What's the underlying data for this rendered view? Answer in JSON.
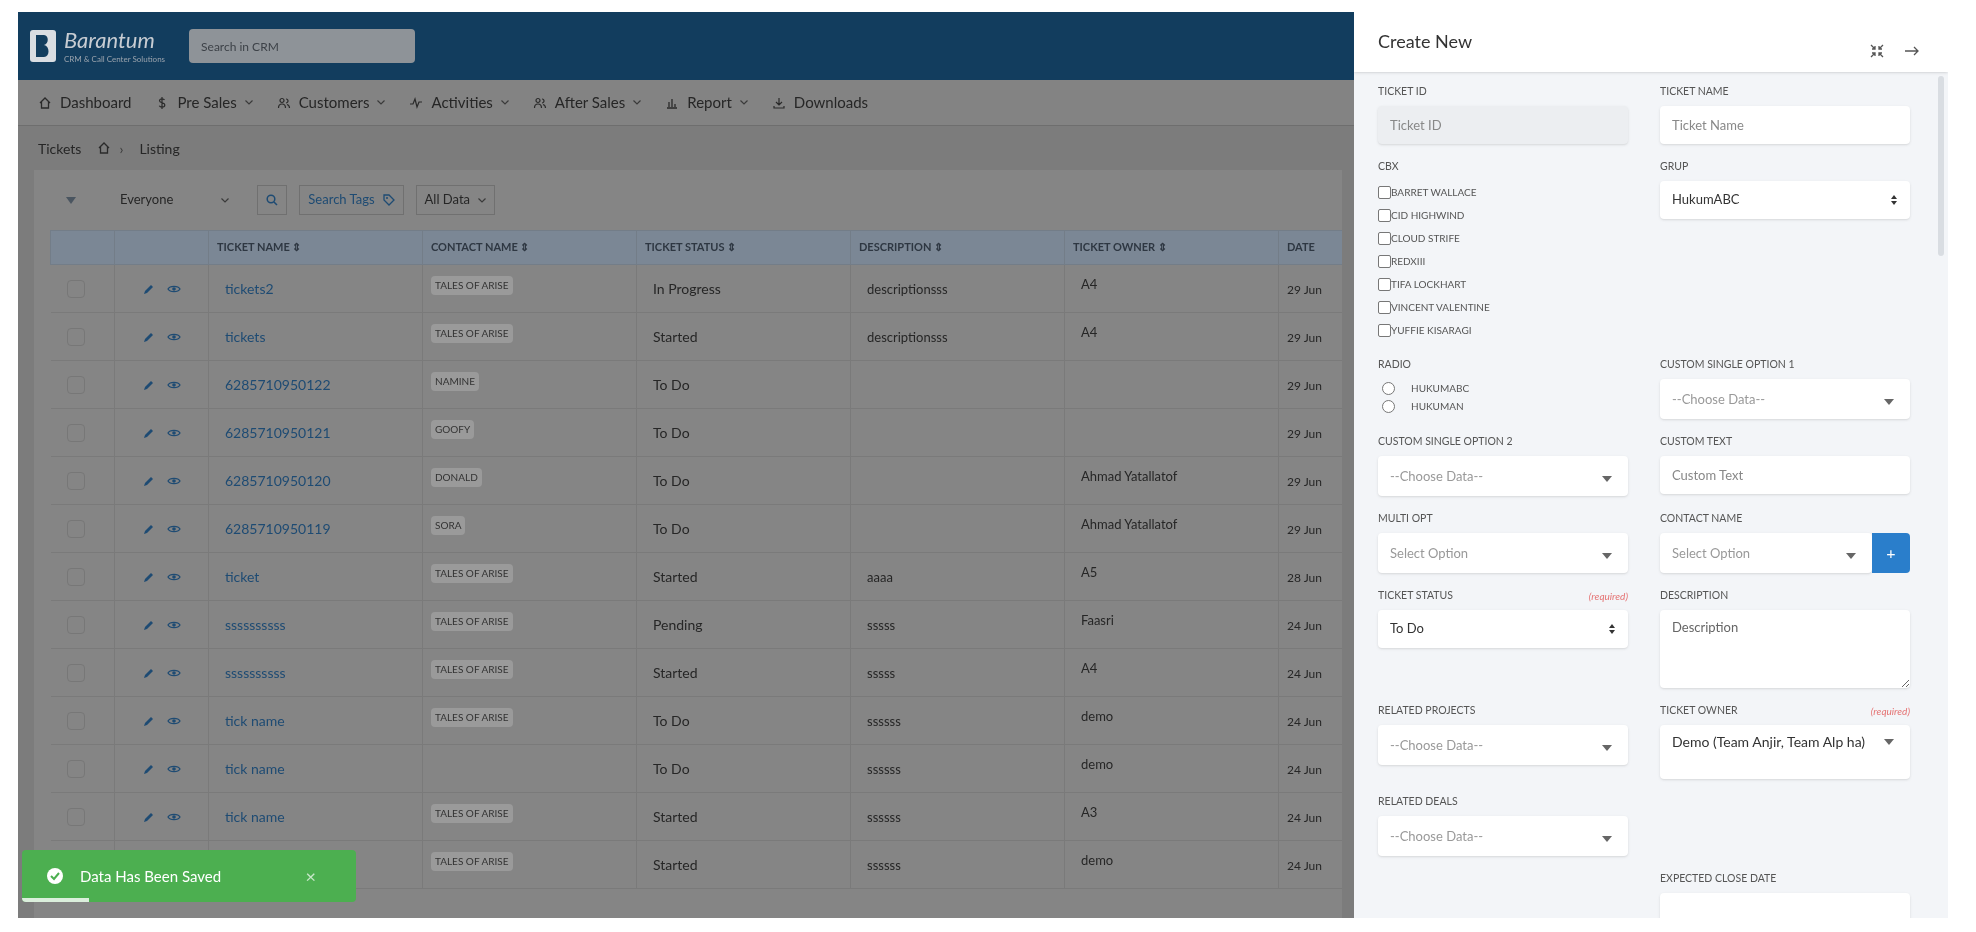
{
  "header": {
    "logo": "Barantum",
    "tagline": "CRM & Call Center Solutions",
    "search": {
      "placeholder": "Search in CRM"
    }
  },
  "nav": [
    {
      "label": "Dashboard",
      "dropdown": false
    },
    {
      "label": "Pre Sales",
      "dropdown": true
    },
    {
      "label": "Customers",
      "dropdown": true
    },
    {
      "label": "Activities",
      "dropdown": true
    },
    {
      "label": "After Sales",
      "dropdown": true
    },
    {
      "label": "Report",
      "dropdown": true
    },
    {
      "label": "Downloads",
      "dropdown": false
    }
  ],
  "breadcrumb": {
    "title": "Tickets",
    "separator": "›",
    "current": "Listing"
  },
  "toolbar": {
    "owner_filter": "Everyone",
    "tags_button": "Search Tags",
    "data_filter": "All Data"
  },
  "table": {
    "columns": [
      "TICKET NAME ⇕",
      "CONTACT NAME ⇕",
      "TICKET STATUS ⇕",
      "DESCRIPTION ⇕",
      "TICKET OWNER ⇕",
      "DATE"
    ],
    "rows": [
      {
        "checked": false,
        "ticket_name": "tickets2",
        "contact": "TALES OF ARISE",
        "status": "In Progress",
        "description": "descriptionsss",
        "owner": "A4",
        "date": "29 Jun"
      },
      {
        "checked": false,
        "ticket_name": "tickets",
        "contact": "TALES OF ARISE",
        "status": "Started",
        "description": "descriptionsss",
        "owner": "A4",
        "date": "29 Jun"
      },
      {
        "checked": false,
        "ticket_name": "6285710950122",
        "contact": "NAMINE",
        "status": "To Do",
        "date": "29 Jun"
      },
      {
        "checked": false,
        "ticket_name": "6285710950121",
        "contact": "GOOFY",
        "status": "To Do",
        "date": "29 Jun"
      },
      {
        "checked": false,
        "ticket_name": "6285710950120",
        "contact": "DONALD",
        "status": "To Do",
        "owner": "Ahmad Yatallatof",
        "date": "29 Jun"
      },
      {
        "checked": false,
        "ticket_name": "6285710950119",
        "contact": "SORA",
        "status": "To Do",
        "owner": "Ahmad Yatallatof",
        "date": "29 Jun"
      },
      {
        "checked": false,
        "ticket_name": "ticket",
        "contact": "TALES OF ARISE",
        "status": "Started",
        "description": "aaaa",
        "owner": "A5",
        "date": "28 Jun"
      },
      {
        "checked": false,
        "ticket_name": "ssssssssss",
        "contact": "TALES OF ARISE",
        "status": "Pending",
        "description": "sssss",
        "owner": "Faasri",
        "date": "24 Jun"
      },
      {
        "checked": false,
        "ticket_name": "ssssssssss",
        "contact": "TALES OF ARISE",
        "status": "Started",
        "description": "sssss",
        "owner": "A4",
        "date": "24 Jun"
      },
      {
        "checked": false,
        "ticket_name": "tick name",
        "contact": "TALES OF ARISE",
        "status": "To Do",
        "description": "ssssss",
        "owner": "demo",
        "date": "24 Jun"
      },
      {
        "checked": false,
        "ticket_name": "tick name",
        "status": "To Do",
        "description": "ssssss",
        "owner": "demo",
        "date": "24 Jun"
      },
      {
        "checked": false,
        "ticket_name": "tick name",
        "contact": "TALES OF ARISE",
        "status": "Started",
        "description": "ssssss",
        "owner": "A3",
        "date": "24 Jun"
      },
      {
        "contact": "TALES OF ARISE",
        "status": "Started",
        "description": "ssssss",
        "owner": "demo",
        "date": "24 Jun"
      }
    ]
  },
  "toast": {
    "message": "Data Has Been Saved",
    "close": "×",
    "level": 0.2
  },
  "panel": {
    "title": "Create New",
    "rows": [
      {
        "left": {
          "kind": "input",
          "label": "TICKET ID",
          "placeholder": "Ticket ID",
          "disabled": true
        },
        "right": {
          "kind": "input",
          "label": "TICKET NAME",
          "placeholder": "Ticket Name",
          "disabled": false
        }
      },
      {
        "left": {
          "kind": "checkboxes",
          "label": "CBX",
          "options": [
            {
              "label": "BARRET WALLACE",
              "checked": false
            },
            {
              "label": "CID HIGHWIND",
              "checked": false
            },
            {
              "label": "CLOUD STRIFE",
              "checked": false
            },
            {
              "label": "REDXIII",
              "checked": false
            },
            {
              "label": "TIFA LOCKHART",
              "checked": false
            },
            {
              "label": "VINCENT VALENTINE",
              "checked": false
            },
            {
              "label": "YUFFIE KISARAGI",
              "checked": false
            }
          ]
        },
        "right": {
          "kind": "select",
          "label": "GRUP",
          "value": "HukumABC"
        }
      },
      {
        "left": {
          "kind": "radios",
          "label": "RADIO",
          "options": [
            {
              "label": "HUKUMABC",
              "selected": false
            },
            {
              "label": "HUKUMAN",
              "selected": false
            }
          ]
        },
        "right": {
          "kind": "dropdown",
          "label": "CUSTOM SINGLE OPTION 1",
          "placeholder": "--Choose Data--"
        }
      },
      {
        "left": {
          "kind": "dropdown",
          "label": "CUSTOM SINGLE OPTION 2",
          "placeholder": "--Choose Data--"
        },
        "right": {
          "kind": "input",
          "label": "CUSTOM TEXT",
          "placeholder": "Custom Text",
          "disabled": false
        }
      },
      {
        "left": {
          "kind": "dropdown",
          "label": "MULTI OPT",
          "placeholder": "Select Option"
        },
        "right": {
          "kind": "dropdown",
          "label": "CONTACT NAME",
          "placeholder": "Select Option",
          "add_button": "+"
        }
      },
      {
        "left": {
          "kind": "select",
          "label": "TICKET STATUS",
          "required": "(required)",
          "value": "To Do"
        },
        "right": {
          "kind": "textarea",
          "label": "DESCRIPTION",
          "placeholder": "Description"
        }
      },
      {
        "left": {
          "kind": "dropdown",
          "label": "RELATED PROJECTS",
          "placeholder": "--Choose Data--"
        },
        "right": {
          "kind": "dropdown",
          "label": "TICKET OWNER",
          "required": "(required)",
          "value": "Demo (Team Anjir, Team Alp ha)"
        }
      },
      {
        "left": {
          "kind": "dropdown",
          "label": "RELATED DEALS",
          "placeholder": "--Choose Data--"
        }
      },
      {
        "right": {
          "kind": "input",
          "label": "EXPECTED CLOSE DATE"
        }
      }
    ]
  }
}
